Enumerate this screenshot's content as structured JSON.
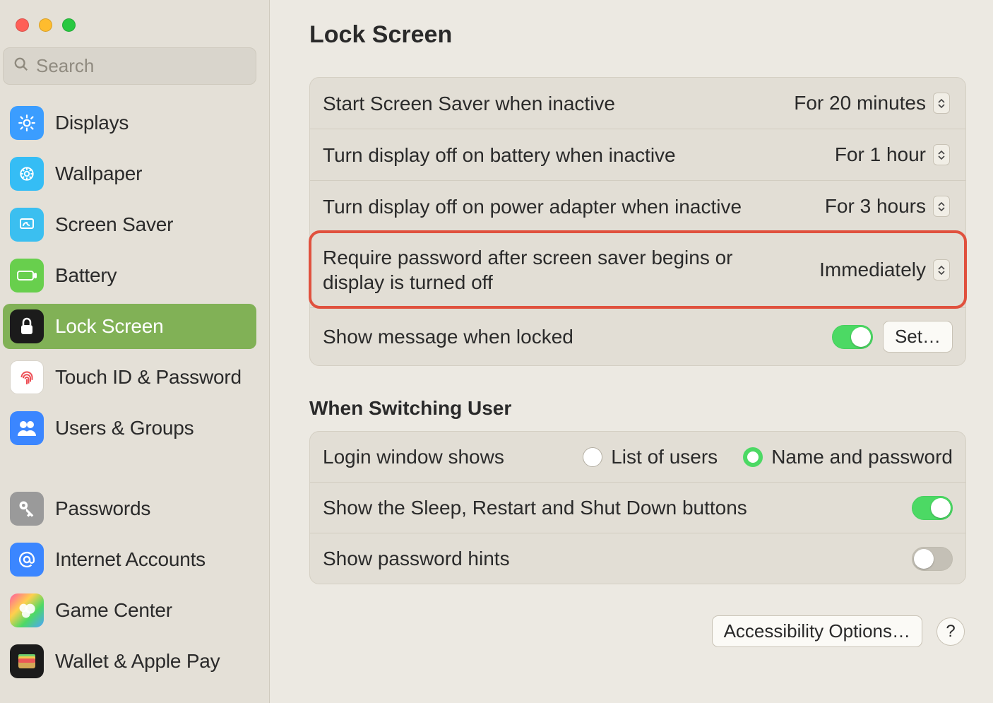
{
  "search": {
    "placeholder": "Search"
  },
  "sidebar": {
    "items": [
      {
        "label": "Displays"
      },
      {
        "label": "Wallpaper"
      },
      {
        "label": "Screen Saver"
      },
      {
        "label": "Battery"
      },
      {
        "label": "Lock Screen"
      },
      {
        "label": "Touch ID & Password"
      },
      {
        "label": "Users & Groups"
      },
      {
        "label": "Passwords"
      },
      {
        "label": "Internet Accounts"
      },
      {
        "label": "Game Center"
      },
      {
        "label": "Wallet & Apple Pay"
      }
    ]
  },
  "page": {
    "title": "Lock Screen",
    "rows": {
      "screensaver": {
        "label": "Start Screen Saver when inactive",
        "value": "For 20 minutes"
      },
      "display_battery": {
        "label": "Turn display off on battery when inactive",
        "value": "For 1 hour"
      },
      "display_power": {
        "label": "Turn display off on power adapter when inactive",
        "value": "For 3 hours"
      },
      "require_password": {
        "label": "Require password after screen saver begins or display is turned off",
        "value": "Immediately"
      },
      "show_message": {
        "label": "Show message when locked",
        "button": "Set…"
      }
    },
    "section2": {
      "heading": "When Switching User",
      "login_window": {
        "label": "Login window shows",
        "option1": "List of users",
        "option2": "Name and password"
      },
      "sleep_buttons": {
        "label": "Show the Sleep, Restart and Shut Down buttons"
      },
      "password_hints": {
        "label": "Show password hints"
      }
    },
    "footer": {
      "accessibility": "Accessibility Options…",
      "help": "?"
    }
  }
}
